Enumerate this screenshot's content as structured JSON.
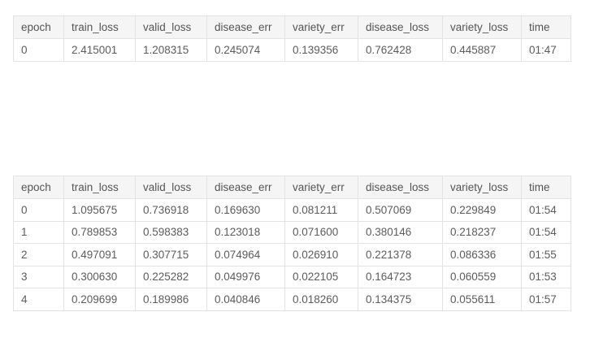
{
  "tables": [
    {
      "headers": [
        "epoch",
        "train_loss",
        "valid_loss",
        "disease_err",
        "variety_err",
        "disease_loss",
        "variety_loss",
        "time"
      ],
      "rows": [
        [
          "0",
          "2.415001",
          "1.208315",
          "0.245074",
          "0.139356",
          "0.762428",
          "0.445887",
          "01:47"
        ]
      ]
    },
    {
      "headers": [
        "epoch",
        "train_loss",
        "valid_loss",
        "disease_err",
        "variety_err",
        "disease_loss",
        "variety_loss",
        "time"
      ],
      "rows": [
        [
          "0",
          "1.095675",
          "0.736918",
          "0.169630",
          "0.081211",
          "0.507069",
          "0.229849",
          "01:54"
        ],
        [
          "1",
          "0.789853",
          "0.598383",
          "0.123018",
          "0.071600",
          "0.380146",
          "0.218237",
          "01:54"
        ],
        [
          "2",
          "0.497091",
          "0.307715",
          "0.074964",
          "0.026910",
          "0.221378",
          "0.086336",
          "01:55"
        ],
        [
          "3",
          "0.300630",
          "0.225282",
          "0.049976",
          "0.022105",
          "0.164723",
          "0.060559",
          "01:53"
        ],
        [
          "4",
          "0.209699",
          "0.189986",
          "0.040846",
          "0.018260",
          "0.134375",
          "0.055611",
          "01:57"
        ]
      ]
    }
  ]
}
